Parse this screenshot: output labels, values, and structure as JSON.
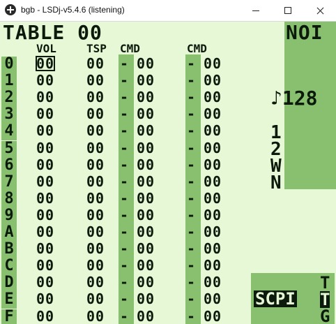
{
  "window": {
    "title": "bgb - LSDj-v5.4.6 (listening)"
  },
  "screen": {
    "title": "TABLE 00",
    "headers": {
      "vol": "VOL",
      "tsp": "TSP",
      "cmd1": "CMD",
      "cmd2": "CMD"
    },
    "instrument": "NOI",
    "tempo": "♪128",
    "channels": [
      "1",
      "2",
      "W",
      "N"
    ],
    "nav": {
      "label": "SCPI",
      "letters": [
        "T",
        "T",
        "G"
      ]
    },
    "rows": [
      {
        "idx": "0",
        "vol": "00",
        "tsp": "00",
        "cmd1": "-",
        "v1": "00",
        "cmd2": "-",
        "v2": "00"
      },
      {
        "idx": "1",
        "vol": "00",
        "tsp": "00",
        "cmd1": "-",
        "v1": "00",
        "cmd2": "-",
        "v2": "00"
      },
      {
        "idx": "2",
        "vol": "00",
        "tsp": "00",
        "cmd1": "-",
        "v1": "00",
        "cmd2": "-",
        "v2": "00"
      },
      {
        "idx": "3",
        "vol": "00",
        "tsp": "00",
        "cmd1": "-",
        "v1": "00",
        "cmd2": "-",
        "v2": "00"
      },
      {
        "idx": "4",
        "vol": "00",
        "tsp": "00",
        "cmd1": "-",
        "v1": "00",
        "cmd2": "-",
        "v2": "00"
      },
      {
        "idx": "5",
        "vol": "00",
        "tsp": "00",
        "cmd1": "-",
        "v1": "00",
        "cmd2": "-",
        "v2": "00"
      },
      {
        "idx": "6",
        "vol": "00",
        "tsp": "00",
        "cmd1": "-",
        "v1": "00",
        "cmd2": "-",
        "v2": "00"
      },
      {
        "idx": "7",
        "vol": "00",
        "tsp": "00",
        "cmd1": "-",
        "v1": "00",
        "cmd2": "-",
        "v2": "00"
      },
      {
        "idx": "8",
        "vol": "00",
        "tsp": "00",
        "cmd1": "-",
        "v1": "00",
        "cmd2": "-",
        "v2": "00"
      },
      {
        "idx": "9",
        "vol": "00",
        "tsp": "00",
        "cmd1": "-",
        "v1": "00",
        "cmd2": "-",
        "v2": "00"
      },
      {
        "idx": "A",
        "vol": "00",
        "tsp": "00",
        "cmd1": "-",
        "v1": "00",
        "cmd2": "-",
        "v2": "00"
      },
      {
        "idx": "B",
        "vol": "00",
        "tsp": "00",
        "cmd1": "-",
        "v1": "00",
        "cmd2": "-",
        "v2": "00"
      },
      {
        "idx": "C",
        "vol": "00",
        "tsp": "00",
        "cmd1": "-",
        "v1": "00",
        "cmd2": "-",
        "v2": "00"
      },
      {
        "idx": "D",
        "vol": "00",
        "tsp": "00",
        "cmd1": "-",
        "v1": "00",
        "cmd2": "-",
        "v2": "00"
      },
      {
        "idx": "E",
        "vol": "00",
        "tsp": "00",
        "cmd1": "-",
        "v1": "00",
        "cmd2": "-",
        "v2": "00"
      },
      {
        "idx": "F",
        "vol": "00",
        "tsp": "00",
        "cmd1": "-",
        "v1": "00",
        "cmd2": "-",
        "v2": "00"
      }
    ]
  },
  "colors": {
    "light": "#e6f8d6",
    "mid": "#88c070",
    "dark": "#0b1a0b"
  }
}
